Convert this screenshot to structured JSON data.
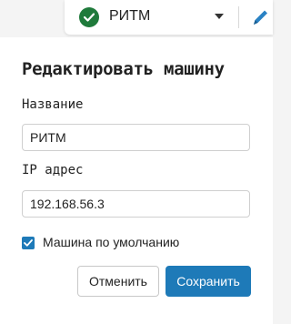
{
  "topbar": {
    "machine_name": "РИТМ",
    "status_icon": "check-circle-icon",
    "edit_icon": "pencil-icon",
    "status_color": "#1f7a3b"
  },
  "dialog": {
    "title": "Редактировать машину",
    "name_label": "Название",
    "name_value": "РИТМ",
    "ip_label": "IP адрес",
    "ip_value": "192.168.56.3",
    "default_checked": true,
    "default_label": "Машина по умолчанию",
    "cancel_label": "Отменить",
    "save_label": "Сохранить",
    "accent_color": "#1e7ab8"
  }
}
